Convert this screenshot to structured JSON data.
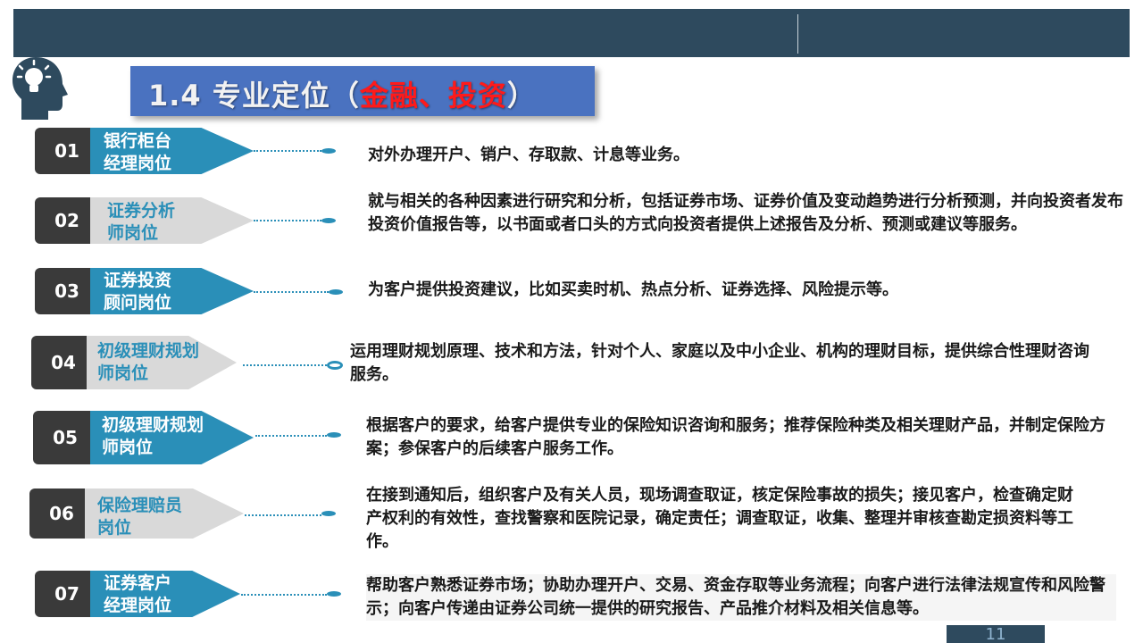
{
  "title": {
    "prefix": "1.4 专业定位（",
    "accent": "金融、投资",
    "suffix": "）"
  },
  "page_number": "11",
  "colors": {
    "header": "#2e4a5e",
    "accent_blue": "#2a8fb8",
    "number_box": "#3a3a3a",
    "title_box": "#4a72c0",
    "title_accent": "#ff1a1a"
  },
  "roles": [
    {
      "num": "01",
      "label_line1": "银行柜台",
      "label_line2": "经理岗位",
      "style": "blue",
      "description": "对外办理开户、销户、存取款、计息等业务。"
    },
    {
      "num": "02",
      "label_line1": "证券分析",
      "label_line2": "师岗位",
      "style": "gray",
      "description": "就与相关的各种因素进行研究和分析，包括证券市场、证券价值及变动趋势进行分析预测，并向投资者发布投资价值报告等，以书面或者口头的方式向投资者提供上述报告及分析、预测或建议等服务。"
    },
    {
      "num": "03",
      "label_line1": "证券投资",
      "label_line2": "顾问岗位",
      "style": "blue",
      "description": "为客户提供投资建议，比如买卖时机、热点分析、证券选择、风险提示等。"
    },
    {
      "num": "04",
      "label_line1": "初级理财规划",
      "label_line2": "师岗位",
      "style": "gray",
      "description": "运用理财规划原理、技术和方法，针对个人、家庭以及中小企业、机构的理财目标，提供综合性理财咨询服务。"
    },
    {
      "num": "05",
      "label_line1": "初级理财规划",
      "label_line2": "师岗位",
      "style": "blue",
      "description": "根据客户的要求，给客户提供专业的保险知识咨询和服务；推荐保险种类及相关理财产品，并制定保险方案；参保客户的后续客户服务工作。"
    },
    {
      "num": "06",
      "label_line1": "保险理赔员",
      "label_line2": "岗位",
      "style": "gray",
      "description": "在接到通知后，组织客户及有关人员，现场调查取证，核定保险事故的损失；接见客户，检查确定财产权利的有效性，查找警察和医院记录，确定责任；调查取证，收集、整理并审核查勘定损资料等工作。"
    },
    {
      "num": "07",
      "label_line1": "证券客户",
      "label_line2": "经理岗位",
      "style": "blue",
      "description": "帮助客户熟悉证券市场；协助办理开户、交易、资金存取等业务流程；向客户进行法律法规宣传和风险警示；向客户传递由证券公司统一提供的研究报告、产品推介材料及相关信息等。"
    }
  ]
}
